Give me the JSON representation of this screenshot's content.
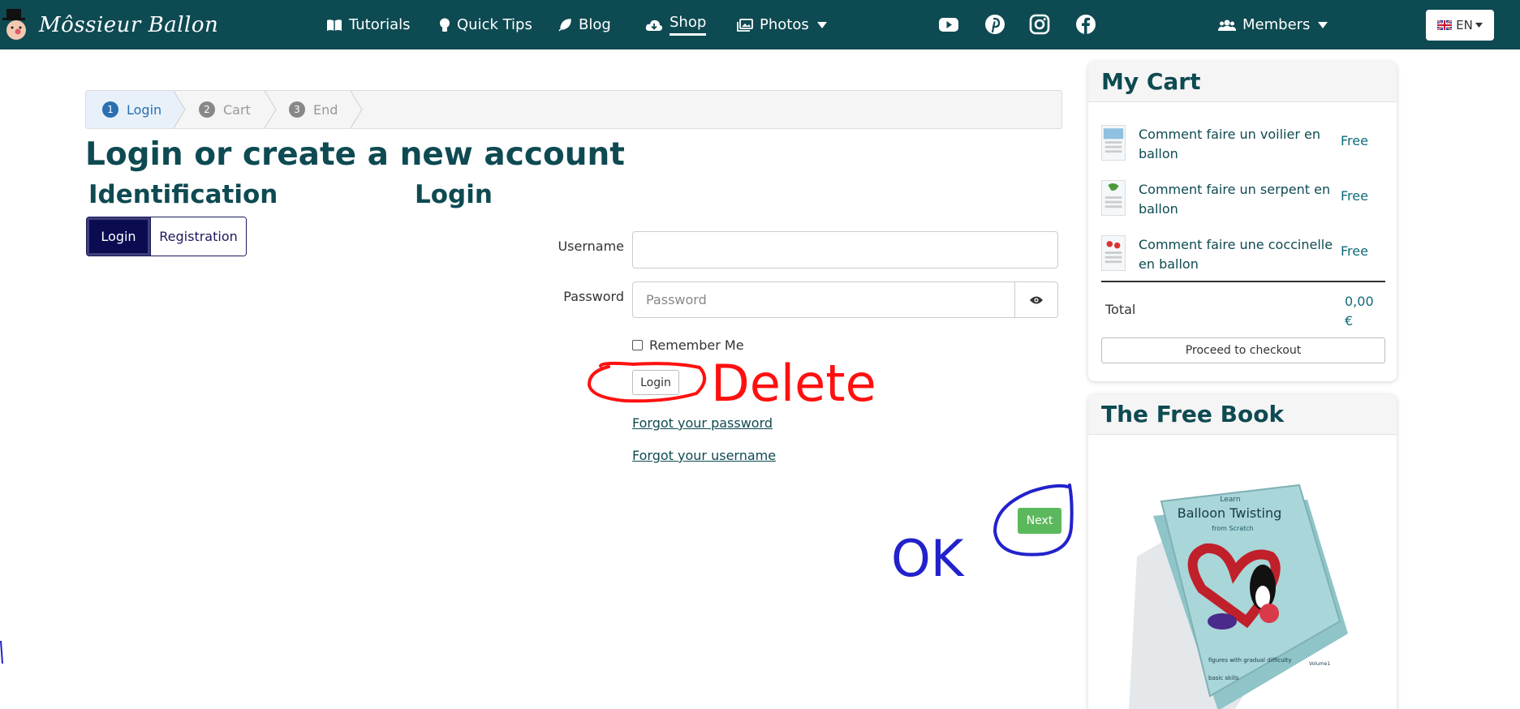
{
  "brand": {
    "name": "Môssieur Ballon"
  },
  "nav": {
    "items": [
      {
        "label": "Tutorials",
        "icon": "book-icon"
      },
      {
        "label": "Quick Tips",
        "icon": "lightbulb-icon"
      },
      {
        "label": "Blog",
        "icon": "feather-icon"
      },
      {
        "label": "Shop",
        "icon": "cloud-download-icon",
        "active": true
      },
      {
        "label": "Photos",
        "icon": "images-icon",
        "dropdown": true
      }
    ],
    "social": [
      "youtube-icon",
      "pinterest-icon",
      "instagram-icon",
      "facebook-icon"
    ],
    "members_label": "Members",
    "language": "EN"
  },
  "steps": [
    {
      "num": "1",
      "label": "Login",
      "active": true
    },
    {
      "num": "2",
      "label": "Cart"
    },
    {
      "num": "3",
      "label": "End"
    }
  ],
  "page_title": "Login or create a new account",
  "identification": {
    "heading": "Identification",
    "tabs": [
      "Login",
      "Registration"
    ]
  },
  "login": {
    "heading": "Login",
    "username_label": "Username",
    "username_value": "",
    "password_label": "Password",
    "password_placeholder": "Password",
    "remember_label": "Remember Me",
    "login_button": "Login",
    "forgot_password": "Forgot your password",
    "forgot_username": "Forgot your username",
    "next_button": "Next"
  },
  "annotations": {
    "delete_text": "Delete",
    "ok_text": "OK"
  },
  "cart": {
    "title": "My Cart",
    "items": [
      {
        "name": "Comment faire un voilier en ballon",
        "price": "Free"
      },
      {
        "name": "Comment faire un serpent en ballon",
        "price": "Free"
      },
      {
        "name": "Comment faire une coccinelle en ballon",
        "price": "Free"
      }
    ],
    "total_label": "Total",
    "total_value": "0,00 €",
    "checkout_button": "Proceed to checkout"
  },
  "free_book": {
    "title": "The Free Book",
    "book_cover": {
      "small_title": "Learn",
      "title": "Balloon Twisting",
      "subtitle": "from Scratch",
      "bullet1": "figures with gradual difficulty",
      "bullet2": "basic skills",
      "volume": "Volume1"
    }
  },
  "colors": {
    "nav_bg": "#0e4a52",
    "heading": "#0e4a52",
    "accent_green": "#5cb85c",
    "tab_active": "#0b0b52",
    "annotation_red": "#ff0000",
    "annotation_blue": "#2222cc"
  }
}
